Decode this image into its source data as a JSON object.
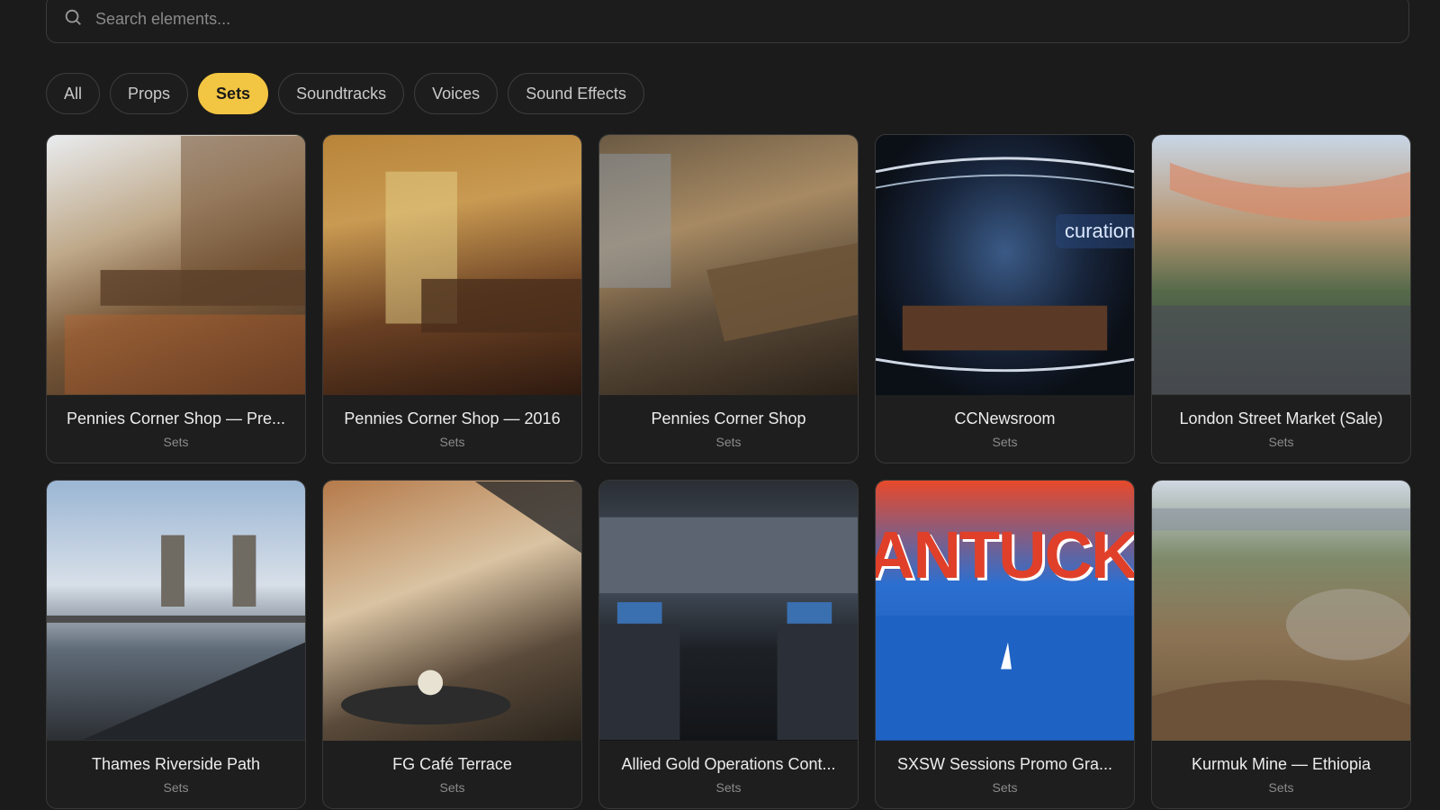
{
  "search": {
    "placeholder": "Search elements..."
  },
  "filters": [
    {
      "label": "All",
      "active": false
    },
    {
      "label": "Props",
      "active": false
    },
    {
      "label": "Sets",
      "active": true
    },
    {
      "label": "Soundtracks",
      "active": false
    },
    {
      "label": "Voices",
      "active": false
    },
    {
      "label": "Sound Effects",
      "active": false
    }
  ],
  "cards": [
    {
      "title": "Pennies Corner Shop — Pre...",
      "type": "Sets"
    },
    {
      "title": "Pennies Corner Shop — 2016",
      "type": "Sets"
    },
    {
      "title": "Pennies Corner Shop",
      "type": "Sets"
    },
    {
      "title": "CCNewsroom",
      "type": "Sets",
      "overlay": "curation"
    },
    {
      "title": "London Street Market (Sale)",
      "type": "Sets"
    },
    {
      "title": "Thames Riverside Path",
      "type": "Sets"
    },
    {
      "title": "FG Café Terrace",
      "type": "Sets"
    },
    {
      "title": "Allied Gold Operations Cont...",
      "type": "Sets"
    },
    {
      "title": "SXSW Sessions Promo Gra...",
      "type": "Sets",
      "overlay": "ANTUCK"
    },
    {
      "title": "Kurmuk Mine — Ethiopia",
      "type": "Sets"
    }
  ],
  "colors": {
    "accent": "#f2c542",
    "background": "#1b1b1b"
  }
}
